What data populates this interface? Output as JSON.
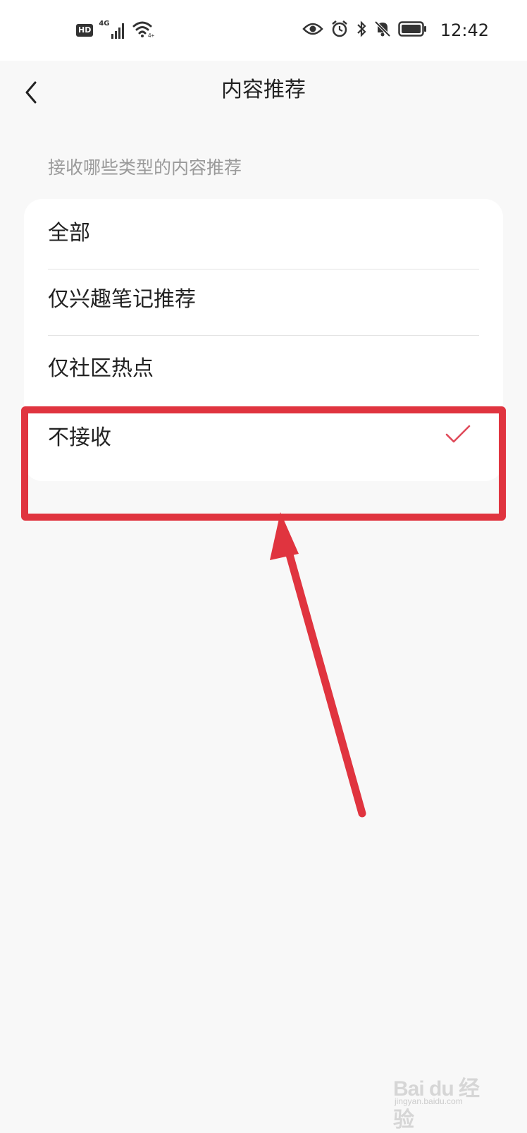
{
  "status_bar": {
    "hd": "HD",
    "network": "4G",
    "time": "12:42",
    "icons": [
      "hd-icon",
      "signal-icon",
      "wifi-icon",
      "eye-icon",
      "alarm-icon",
      "bluetooth-icon",
      "mute-icon",
      "battery-icon"
    ]
  },
  "nav": {
    "title": "内容推荐",
    "back_icon": "chevron-left-icon"
  },
  "section": {
    "hint": "接收哪些类型的内容推荐"
  },
  "options": [
    {
      "label": "全部",
      "selected": false
    },
    {
      "label": "仅兴趣笔记推荐",
      "selected": false
    },
    {
      "label": "仅社区热点",
      "selected": false
    },
    {
      "label": "不接收",
      "selected": true
    }
  ],
  "annotation": {
    "color": "#e0343f"
  },
  "colors": {
    "accent": "#e0343f",
    "check": "#e04a5a",
    "background": "#f8f8f8",
    "card": "#ffffff"
  },
  "watermark": {
    "brand": "Bai du 经验",
    "url": "jingyan.baidu.com"
  }
}
